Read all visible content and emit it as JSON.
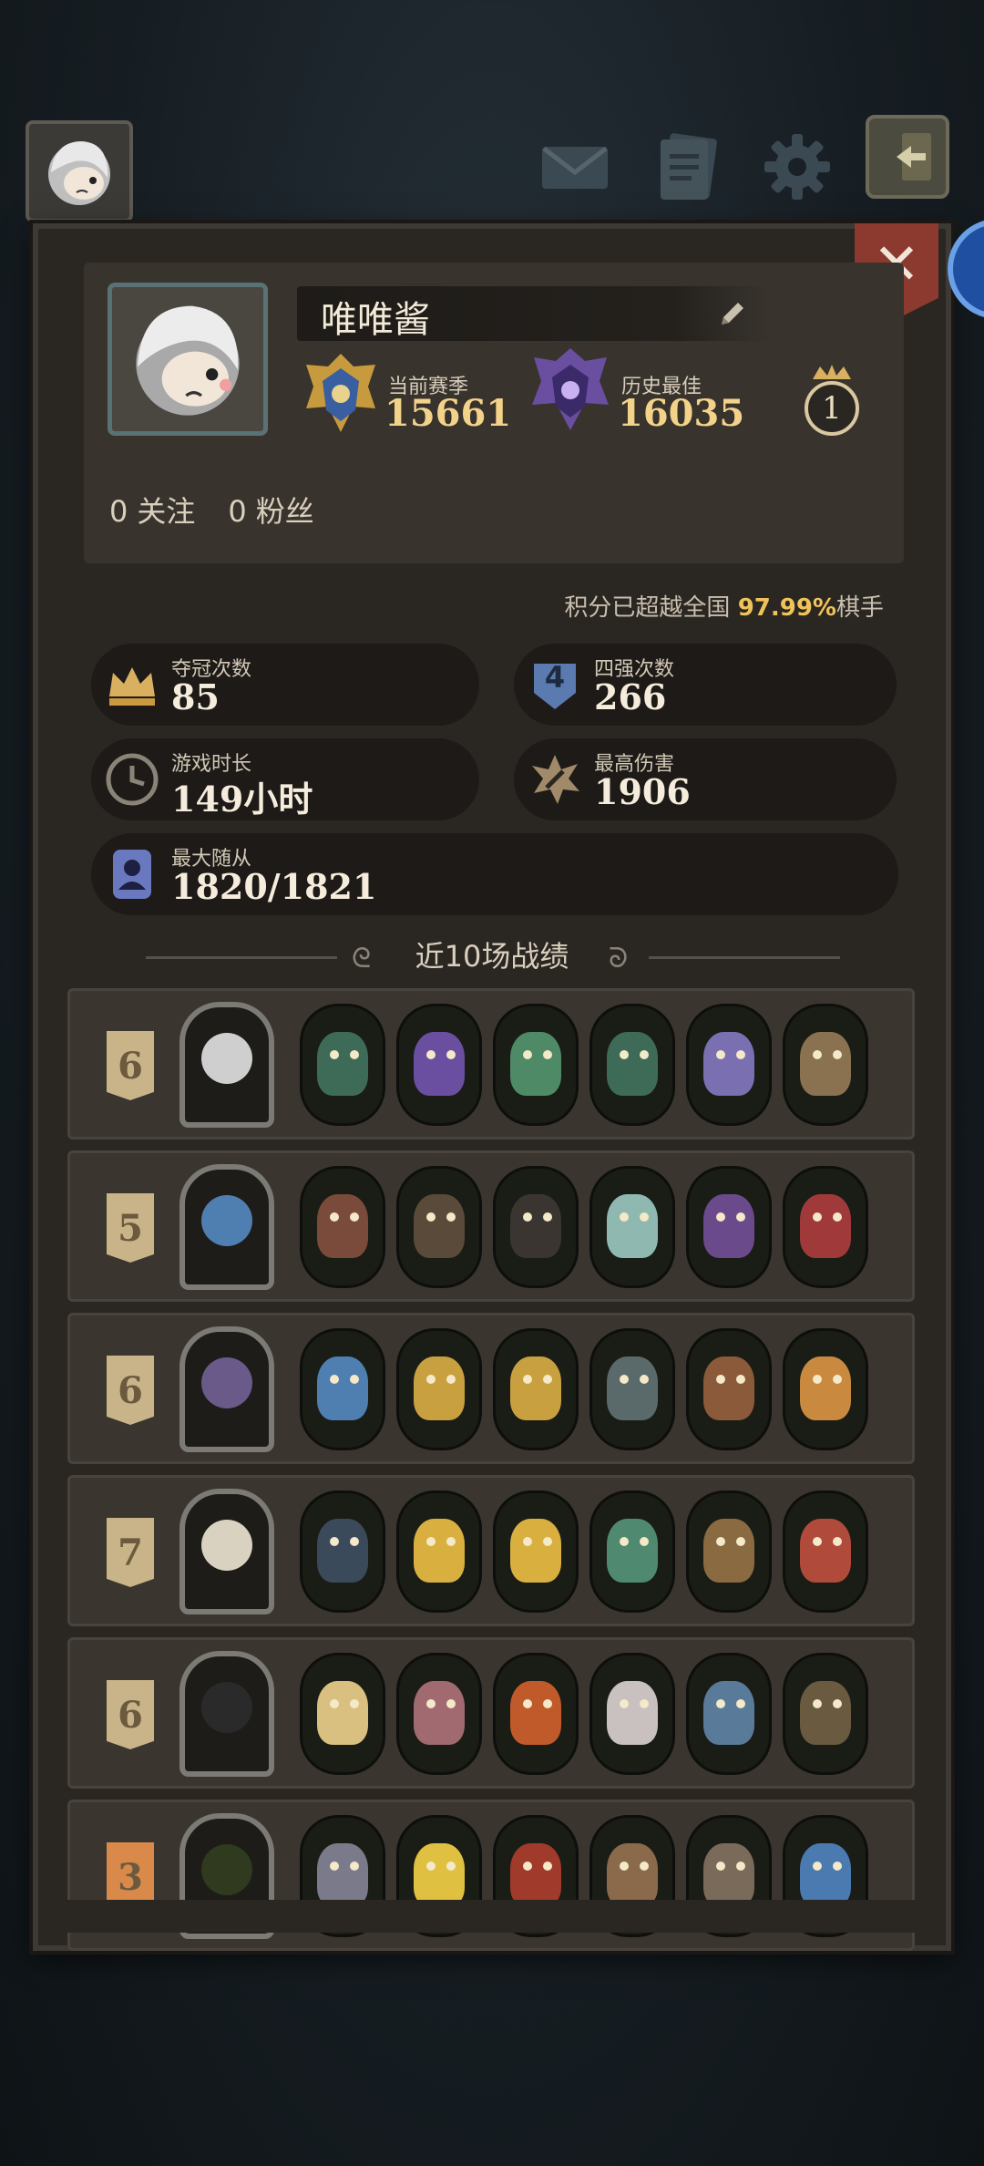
{
  "topbar": {
    "icons": [
      "avatar-icon",
      "mail-icon",
      "notes-icon",
      "gear-icon",
      "exit-icon"
    ]
  },
  "profile": {
    "name": "唯唯酱",
    "season_label": "当前赛季",
    "season_score": "15661",
    "best_label": "历史最佳",
    "best_score": "16035",
    "medal_rank": "1",
    "following_count": "0",
    "following_label": "关注",
    "fans_count": "0",
    "fans_label": "粉丝",
    "percent_prefix": "积分已超越全国 ",
    "percent_value": "97.99%",
    "percent_suffix": "棋手"
  },
  "stats": {
    "champion": {
      "label": "夺冠次数",
      "value": "85"
    },
    "top4": {
      "label": "四强次数",
      "value": "266",
      "icon_text": "4"
    },
    "playtime": {
      "label": "游戏时长",
      "value": "149小时"
    },
    "max_damage": {
      "label": "最高伤害",
      "value": "1906"
    },
    "max_followers": {
      "label": "最大随从",
      "value": "1820/1821"
    }
  },
  "recent": {
    "title": "近10场战绩",
    "matches": [
      {
        "place": "6",
        "hero_color": "#cfcfcf",
        "units": [
          "#3e6b58",
          "#6a4fa0",
          "#4f8a66",
          "#3e6b58",
          "#7a6fb0",
          "#8a7150"
        ]
      },
      {
        "place": "5",
        "hero_color": "#4f7fb0",
        "units": [
          "#7a4a3a",
          "#5a4a3a",
          "#3a3530",
          "#8fb9b0",
          "#6a4a8a",
          "#a03a3a"
        ]
      },
      {
        "place": "6",
        "hero_color": "#6a5a8a",
        "units": [
          "#4f7fb0",
          "#c9a040",
          "#c9a040",
          "#5a6a6a",
          "#8a5a3a",
          "#c98a40"
        ]
      },
      {
        "place": "7",
        "hero_color": "#d9d2c0",
        "units": [
          "#3a4a5a",
          "#d9b040",
          "#d9b040",
          "#4f8a70",
          "#8a6a40",
          "#b04a3a"
        ]
      },
      {
        "place": "6",
        "hero_color": "#2a2a2a",
        "units": [
          "#d9c080",
          "#a06a70",
          "#c05a2a",
          "#c9c0c0",
          "#5a7a9a",
          "#6a5a40"
        ]
      },
      {
        "place": "3",
        "hero_color": "#2f3a1f",
        "units": [
          "#7a7a8a",
          "#e0c040",
          "#a03a2a",
          "#8a6a4a",
          "#7a6a5a",
          "#4a7ab0"
        ]
      }
    ]
  },
  "colors": {
    "panel_bg": "#2a2622",
    "gold_text": "#f3d28a",
    "accent_percent": "#f0c25a",
    "close_red": "#8c3a2f",
    "place_tan": "#c9b48a",
    "place_orange": "#d98a4a"
  }
}
